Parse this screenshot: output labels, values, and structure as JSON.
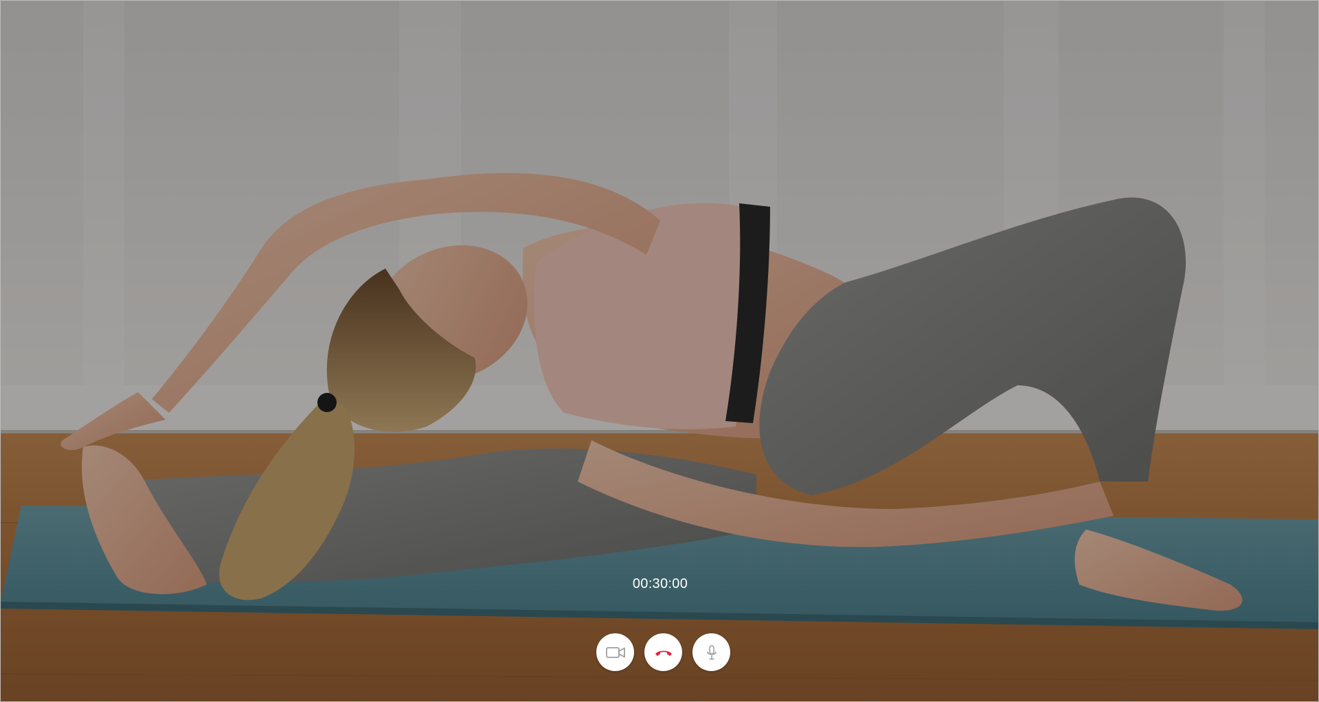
{
  "call": {
    "timer": "00:30:00"
  },
  "controls": {
    "video_icon": "video-camera-icon",
    "end_call_icon": "end-call-icon",
    "mic_icon": "microphone-icon",
    "end_call_color": "#e5243b",
    "icon_color": "#9e9e9e"
  },
  "video": {
    "scene": "person-doing-yoga-stretch-on-mat"
  }
}
